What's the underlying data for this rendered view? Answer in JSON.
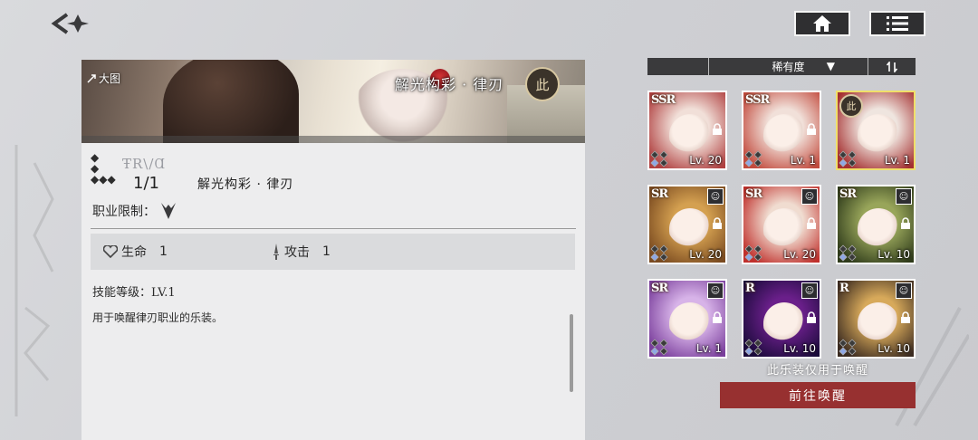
{
  "nav": {
    "back_icon": "back-arrow-icon",
    "home_icon": "home-icon",
    "menu_icon": "list-menu-icon"
  },
  "item": {
    "banner_big_label": "大图",
    "banner_title": "解光构彩 · 律刃",
    "job_emblem_char": "此",
    "rarity_mark": "ŦR\\/Ɑ",
    "count": "1/1",
    "name": "解光构彩 · 律刃",
    "job_limit_label": "职业限制：",
    "stats": {
      "hp_label": "生命",
      "hp_value": "1",
      "atk_label": "攻击",
      "atk_value": "1"
    },
    "skill_level": "技能等级：LV.1",
    "description": "用于唤醒律刃职业的乐装。"
  },
  "sort": {
    "label": "稀有度"
  },
  "cards": [
    {
      "rarity": "SSR",
      "level": "Lv. 20",
      "colors": [
        "#f1dfd8",
        "#b04040"
      ]
    },
    {
      "rarity": "SSR",
      "level": "Lv. 1",
      "colors": [
        "#f1e0d9",
        "#c24b3e"
      ]
    },
    {
      "rarity": "",
      "level": "Lv. 1",
      "colors": [
        "#efe5df",
        "#a53030"
      ],
      "selected": true
    },
    {
      "rarity": "SR",
      "level": "Lv. 20",
      "colors": [
        "#d4a050",
        "#7a4a20"
      ]
    },
    {
      "rarity": "SR",
      "level": "Lv. 20",
      "colors": [
        "#f0dcd0",
        "#c0302c"
      ]
    },
    {
      "rarity": "SR",
      "level": "Lv. 10",
      "colors": [
        "#98a55a",
        "#2e3a1a"
      ]
    },
    {
      "rarity": "SR",
      "level": "Lv. 1",
      "colors": [
        "#d7b3e8",
        "#7a3e9c"
      ]
    },
    {
      "rarity": "R",
      "level": "Lv. 10",
      "colors": [
        "#6a1f8a",
        "#1a0b3a"
      ]
    },
    {
      "rarity": "R",
      "level": "Lv. 10",
      "colors": [
        "#d7a95a",
        "#3a2a20"
      ]
    }
  ],
  "footer": {
    "only_note": "此乐装仅用于唤醒",
    "go_button": "前往唤醒"
  },
  "colors": {
    "go_button": "#973030",
    "selected_border": "#f0e06a",
    "sort_bar": "#3a3a3c"
  }
}
